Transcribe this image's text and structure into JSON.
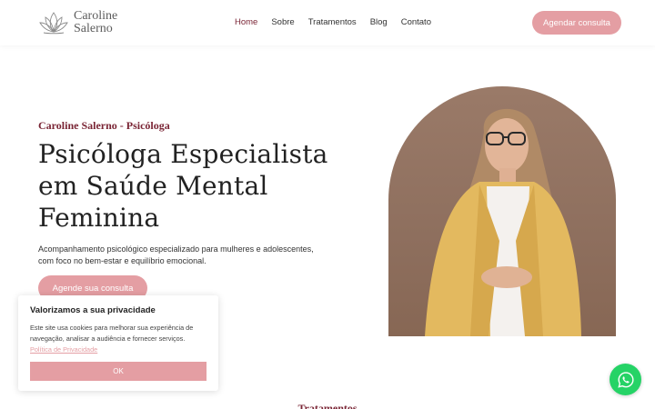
{
  "header": {
    "logo_line1": "Caroline",
    "logo_line2": "Salerno",
    "nav": [
      "Home",
      "Sobre",
      "Tratamentos",
      "Blog",
      "Contato"
    ],
    "cta": "Agendar consulta"
  },
  "hero": {
    "eyebrow": "Caroline Salerno - Psicóloga",
    "title": "Psicóloga Especialista em Saúde Mental Feminina",
    "description": "Acompanhamento psicológico especializado para mulheres e adolescentes, com foco no bem-estar e equilíbrio emocional.",
    "cta": "Agende sua consulta"
  },
  "next_section": {
    "heading": "Tratamentos"
  },
  "cookie": {
    "title": "Valorizamos a sua privacidade",
    "text": "Este site usa cookies para melhorar sua experiência de navegação, analisar a audiência e fornecer serviços.",
    "link": "Política de Privacidade",
    "ok": "OK"
  },
  "colors": {
    "accent": "#e49ea3",
    "brand": "#7a2535",
    "whatsapp": "#25d366"
  },
  "icons": {
    "logo": "lotus-icon",
    "chat": "whatsapp-icon"
  }
}
